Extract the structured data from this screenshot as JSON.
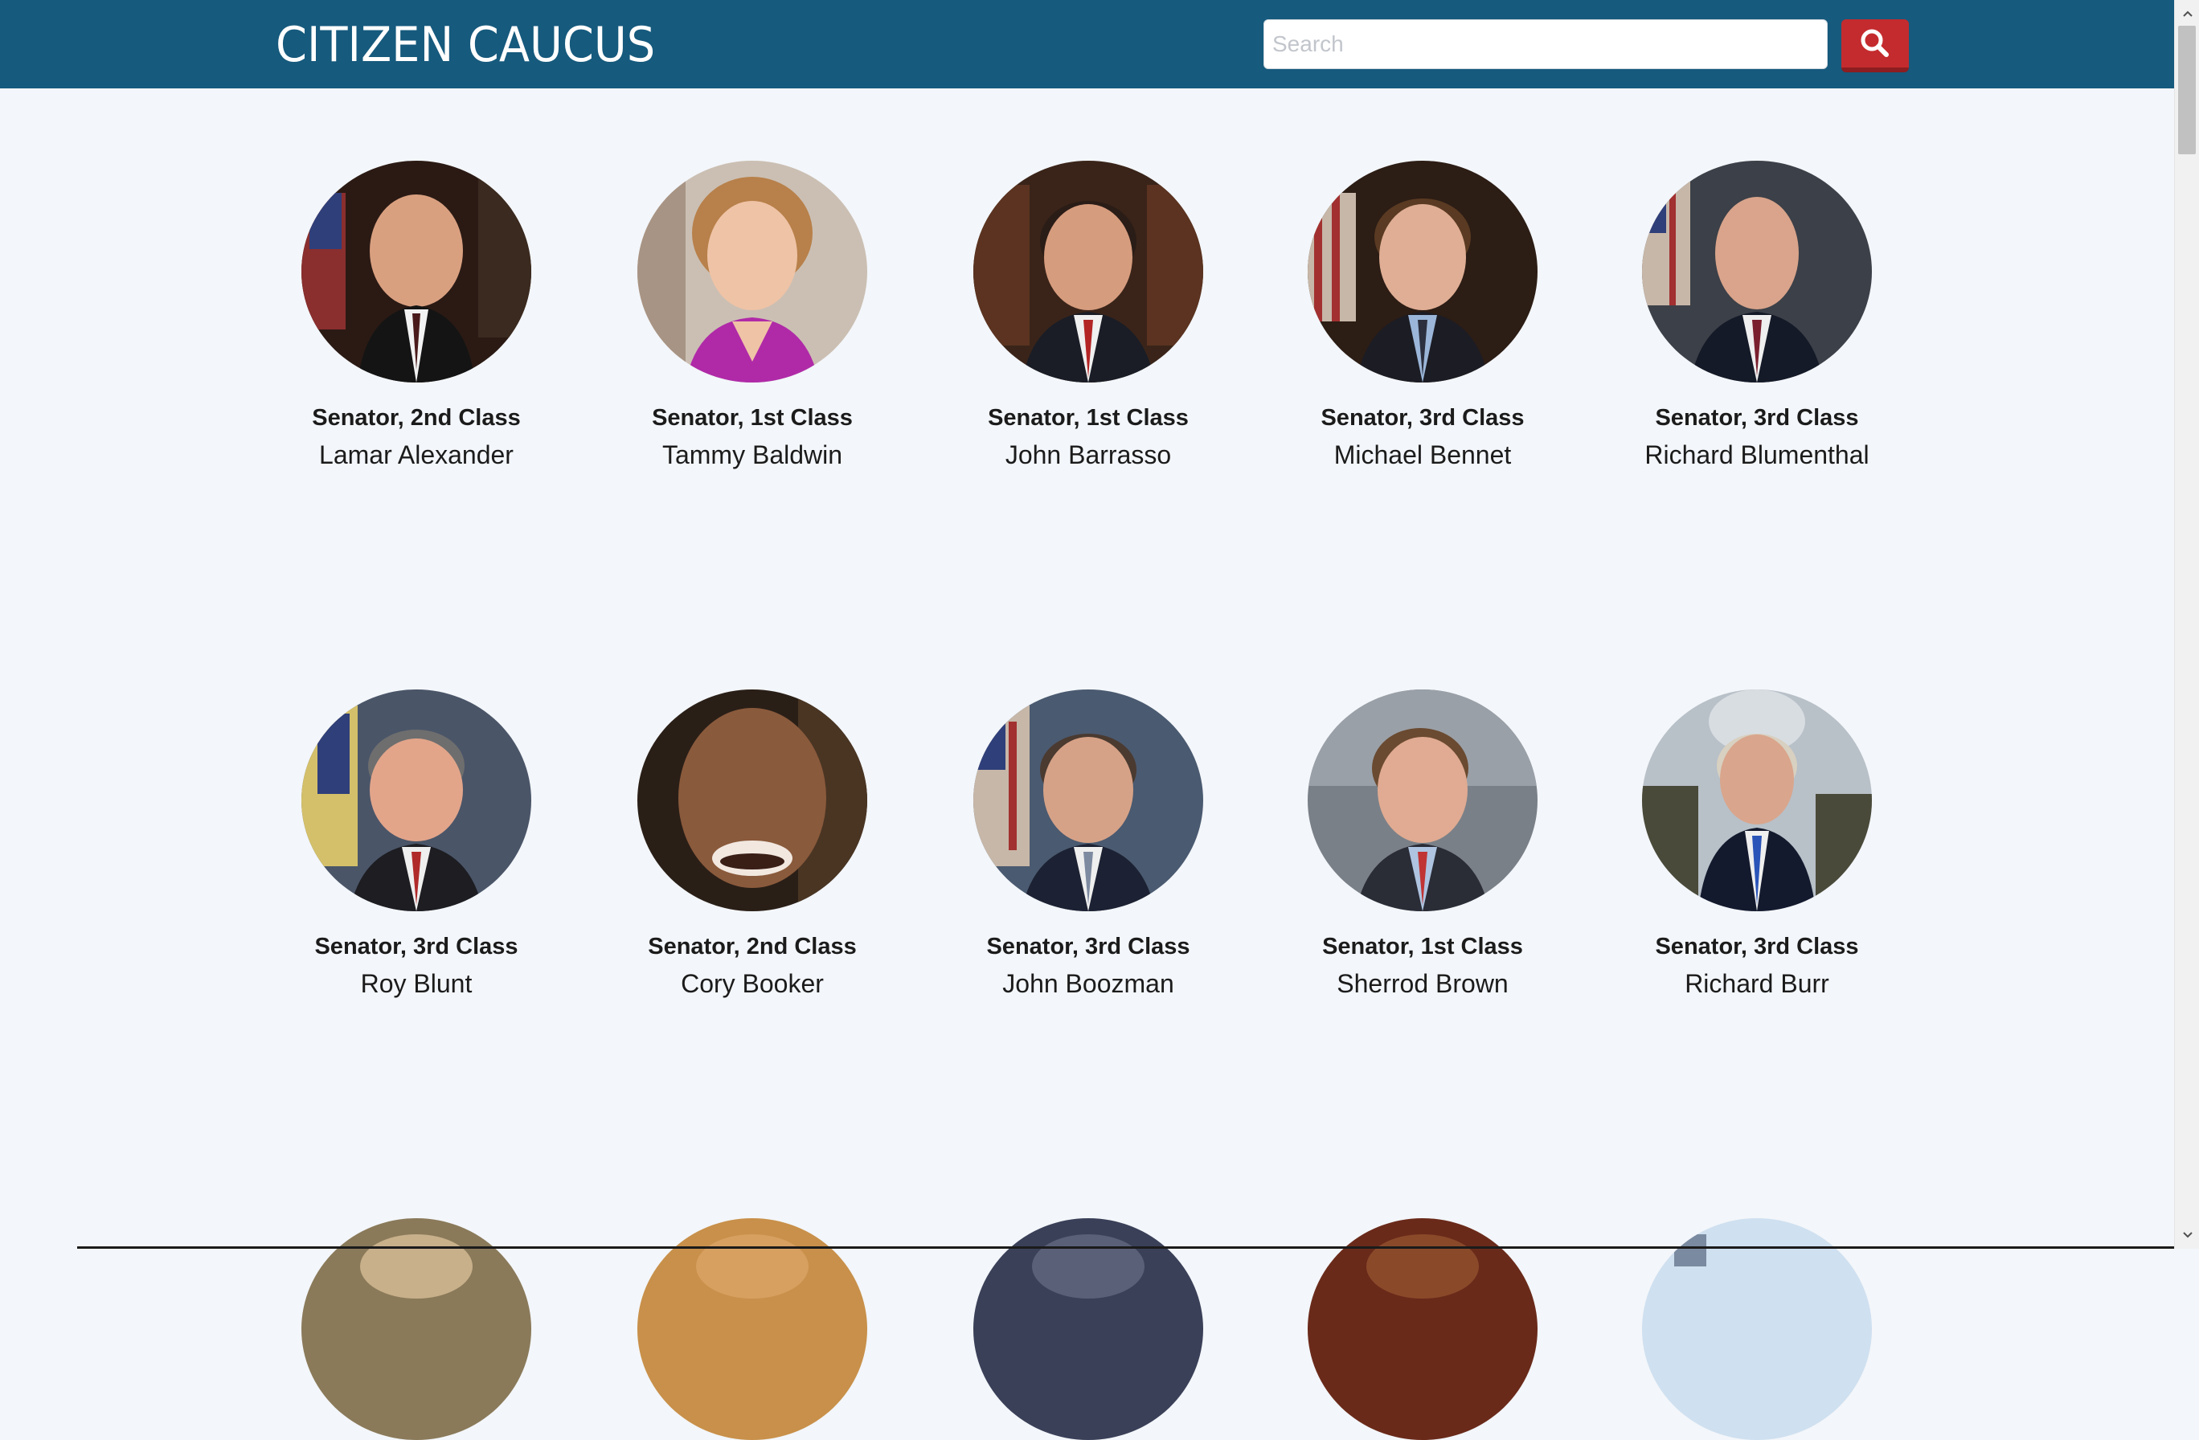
{
  "header": {
    "brand": "CITIZEN CAUCUS",
    "search_placeholder": "Search",
    "search_icon": "magnifier-icon",
    "colors": {
      "navbar": "#165a7d",
      "search_button": "#c42b2e"
    }
  },
  "senators": [
    {
      "title": "Senator, 2nd Class",
      "name": "Lamar Alexander"
    },
    {
      "title": "Senator, 1st Class",
      "name": "Tammy Baldwin"
    },
    {
      "title": "Senator, 1st Class",
      "name": "John Barrasso"
    },
    {
      "title": "Senator, 3rd Class",
      "name": "Michael Bennet"
    },
    {
      "title": "Senator, 3rd Class",
      "name": "Richard Blumenthal"
    },
    {
      "title": "Senator, 3rd Class",
      "name": "Roy Blunt"
    },
    {
      "title": "Senator, 2nd Class",
      "name": "Cory Booker"
    },
    {
      "title": "Senator, 3rd Class",
      "name": "John Boozman"
    },
    {
      "title": "Senator, 1st Class",
      "name": "Sherrod Brown"
    },
    {
      "title": "Senator, 3rd Class",
      "name": "Richard Burr"
    }
  ]
}
